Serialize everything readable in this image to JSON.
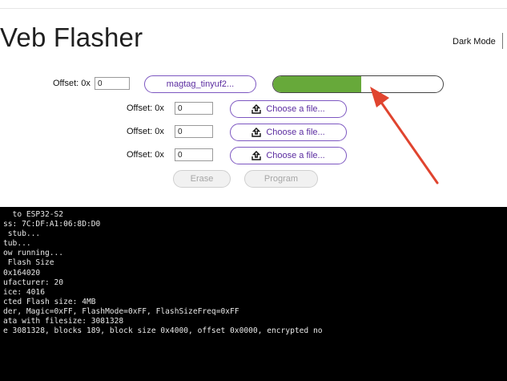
{
  "app": {
    "title": "Veb Flasher",
    "dark_mode_label": "Dark Mode"
  },
  "flasher": {
    "rows": [
      {
        "offset_label": "Offset: 0x",
        "offset_value": "0",
        "file_label": "magtag_tinyuf2..."
      },
      {
        "offset_label": "Offset: 0x",
        "offset_value": "0",
        "file_label": "Choose a file..."
      },
      {
        "offset_label": "Offset: 0x",
        "offset_value": "0",
        "file_label": "Choose a file..."
      },
      {
        "offset_label": "Offset: 0x",
        "offset_value": "0",
        "file_label": "Choose a file..."
      }
    ],
    "progress_fraction": 0.52,
    "erase_label": "Erase",
    "program_label": "Program"
  },
  "colors": {
    "accent": "#7d57c1",
    "progress": "#67a93a",
    "annotation_arrow": "#e0442f",
    "console_bg": "#000000"
  },
  "icons": {
    "upload": "upload-icon",
    "arrow": "annotation-arrow"
  },
  "console": {
    "lines": [
      "  to ESP32-S2",
      "ss: 7C:DF:A1:06:8D:D0",
      " stub...",
      "tub...",
      "ow running...",
      " Flash Size",
      "0x164020",
      "ufacturer: 20",
      "ice: 4016",
      "cted Flash size: 4MB",
      "der, Magic=0xFF, FlashMode=0xFF, FlashSizeFreq=0xFF",
      "ata with filesize: 3081328",
      "e 3081328, blocks 189, block size 0x4000, offset 0x0000, encrypted no"
    ]
  }
}
